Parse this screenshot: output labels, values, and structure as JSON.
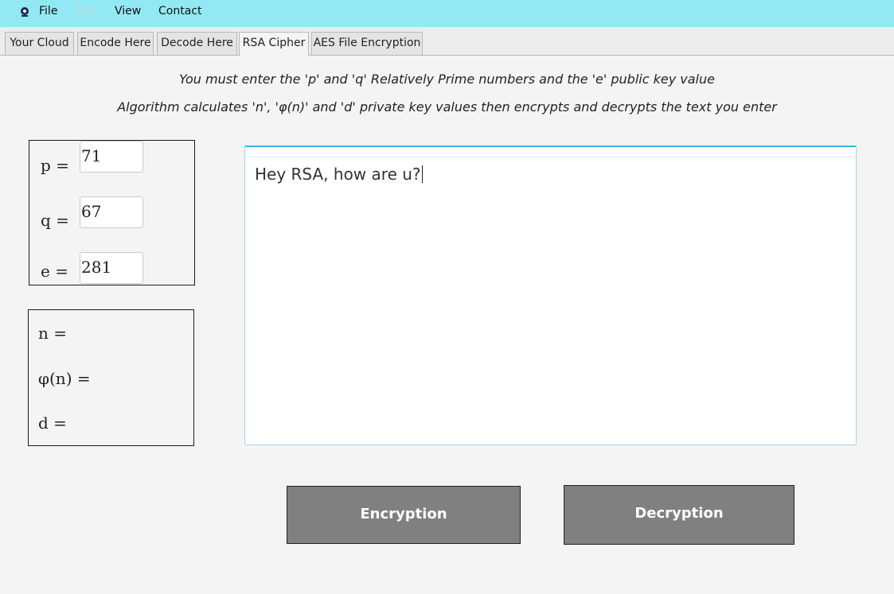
{
  "menu": {
    "items": [
      {
        "label": "File",
        "enabled": true
      },
      {
        "label": "Edit",
        "enabled": false
      },
      {
        "label": "View",
        "enabled": true
      },
      {
        "label": "Contact",
        "enabled": true
      }
    ]
  },
  "tabs": [
    {
      "label": "Your Cloud",
      "active": false
    },
    {
      "label": "Encode Here",
      "active": false
    },
    {
      "label": "Decode Here",
      "active": false
    },
    {
      "label": "RSA Cipher",
      "active": true
    },
    {
      "label": "AES File Encryption",
      "active": false
    }
  ],
  "instructions": {
    "line1": "You must enter the 'p' and 'q' Relatively Prime numbers and the 'e' public key value",
    "line2": "Algorithm calculates 'n', 'φ(n)' and 'd' private key values then encrypts and decrypts the text you enter"
  },
  "inputs": {
    "p_label": "p =",
    "p_value": "71",
    "q_label": "q =",
    "q_value": "67",
    "e_label": "e =",
    "e_value": "281"
  },
  "outputs": {
    "n_label": "n =",
    "phi_label": "φ(n) =",
    "d_label": "d ="
  },
  "message": {
    "text": "Hey RSA, how are u?"
  },
  "buttons": {
    "encrypt_label": "Encryption",
    "decrypt_label": "Decryption"
  },
  "colors": {
    "menubar": "#92e9f3",
    "button": "#808080",
    "focus_border": "#38b8e6"
  }
}
